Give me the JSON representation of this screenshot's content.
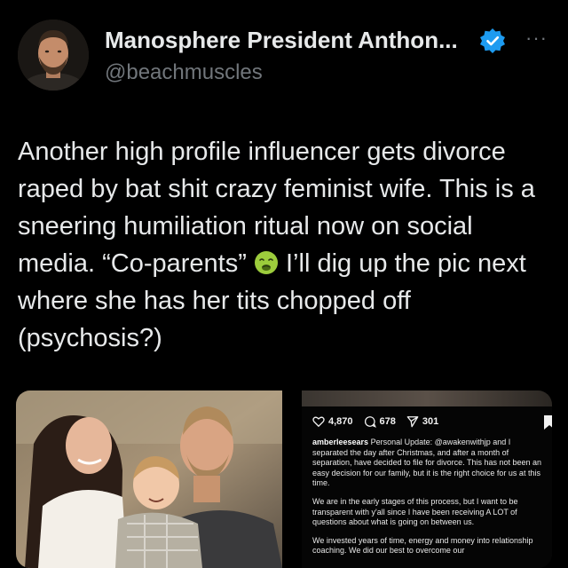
{
  "header": {
    "display_name": "Manosphere President Anthon...",
    "handle": "@beachmuscles"
  },
  "tweet": {
    "text_before_emoji": "Another high profile influencer gets divorce raped by bat shit crazy feminist wife. This is a sneering humiliation ritual now on social media. “Co-parents”",
    "emoji": "nauseated-face-icon",
    "text_after_emoji": "I’ll dig up the pic next where she has her tits chopped off (psychosis?)"
  },
  "embed": {
    "likes": "4,870",
    "comments": "678",
    "shares": "301",
    "username": "amberleesears",
    "para1": "Personal Update: @awakenwithjp and I separated the day after Christmas, and after a month of separation, have decided to file for divorce. This has not been an easy decision for our family, but it is the right choice for us at this time.",
    "para2": "We are in the early stages of this process, but I want to be transparent with y'all since I have been receiving A LOT of questions about what is going on between us.",
    "para3": "We invested years of time, energy and money into relationship coaching. We did our best to overcome our"
  },
  "colors": {
    "background": "#000000",
    "text": "#e7e9ea",
    "secondary": "#71767b",
    "verified": "#1d9bf0"
  }
}
